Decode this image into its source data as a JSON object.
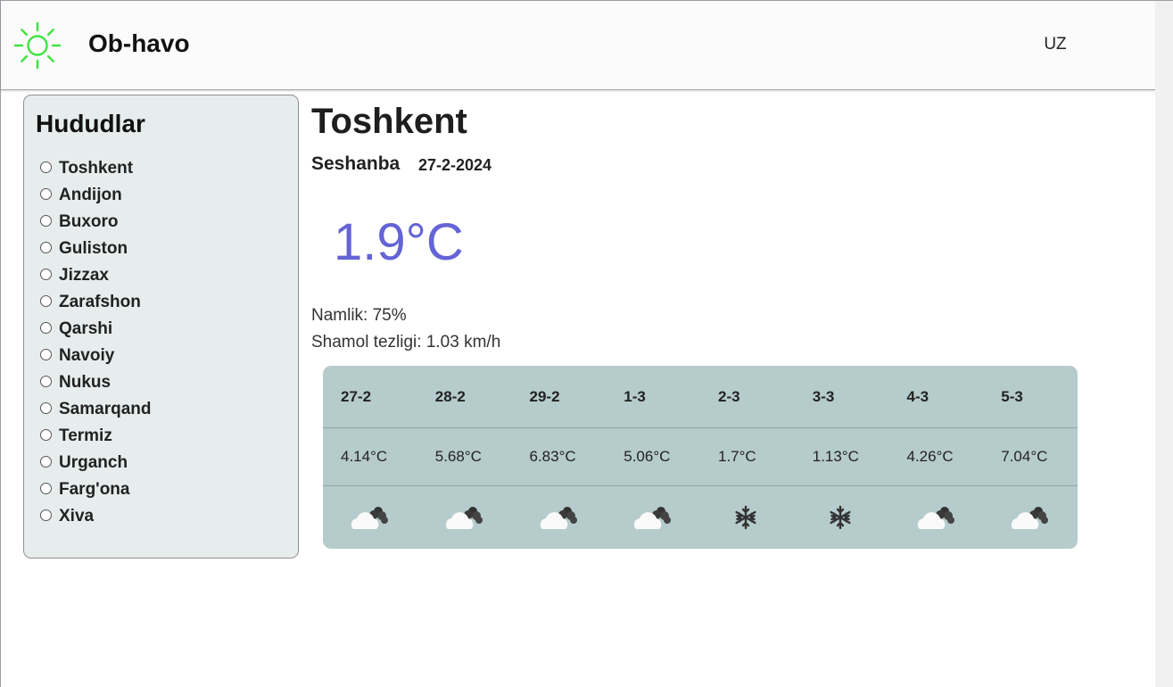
{
  "header": {
    "title": "Ob-havo",
    "logo_icon": "sun-icon",
    "language": "UZ",
    "logo_color": "#3ee23e"
  },
  "sidebar": {
    "title": "Hududlar",
    "regions": [
      "Toshkent",
      "Andijon",
      "Buxoro",
      "Guliston",
      "Jizzax",
      "Zarafshon",
      "Qarshi",
      "Navoiy",
      "Nukus",
      "Samarqand",
      "Termiz",
      "Urganch",
      "Farg'ona",
      "Xiva"
    ]
  },
  "current": {
    "city": "Toshkent",
    "day": "Seshanba",
    "date": "27-2-2024",
    "temperature": "1.9°C",
    "humidity": "Namlik: 75%",
    "wind": "Shamol tezligi: 1.03 km/h",
    "temp_color": "#6464d6"
  },
  "forecast": [
    {
      "date": "27-2",
      "temp": "4.14°C",
      "icon": "cloudy-icon"
    },
    {
      "date": "28-2",
      "temp": "5.68°C",
      "icon": "cloudy-icon"
    },
    {
      "date": "29-2",
      "temp": "6.83°C",
      "icon": "cloudy-icon"
    },
    {
      "date": "1-3",
      "temp": "5.06°C",
      "icon": "cloudy-icon"
    },
    {
      "date": "2-3",
      "temp": "1.7°C",
      "icon": "snow-icon"
    },
    {
      "date": "3-3",
      "temp": "1.13°C",
      "icon": "snow-icon"
    },
    {
      "date": "4-3",
      "temp": "4.26°C",
      "icon": "cloudy-icon"
    },
    {
      "date": "5-3",
      "temp": "7.04°C",
      "icon": "cloudy-icon"
    }
  ],
  "colors": {
    "forecast_bg": "#b6cbcb",
    "sidebar_bg": "#e7eded"
  }
}
